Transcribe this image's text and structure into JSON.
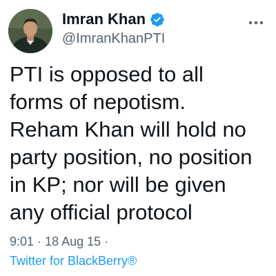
{
  "author": {
    "display_name": "Imran Khan",
    "handle": "@ImranKhanPTI",
    "verified": true,
    "avatar_icon": "profile-photo",
    "verified_icon": "verified-badge-icon"
  },
  "tweet": {
    "text": "PTI is opposed to all\nforms of nepotism.\nReham Khan will hold no\nparty position, no position\nin KP; nor will be given\nany official protocol",
    "time": "9:01",
    "separator": "·",
    "date": "18 Aug 15",
    "separator_trailing": "·",
    "source": "Twitter for BlackBerry®"
  },
  "colors": {
    "text": "#0f1419",
    "secondary": "#536471",
    "link": "#1d9bf0",
    "verified": "#1d9bf0"
  },
  "icons": {
    "more": "more-options-icon"
  }
}
